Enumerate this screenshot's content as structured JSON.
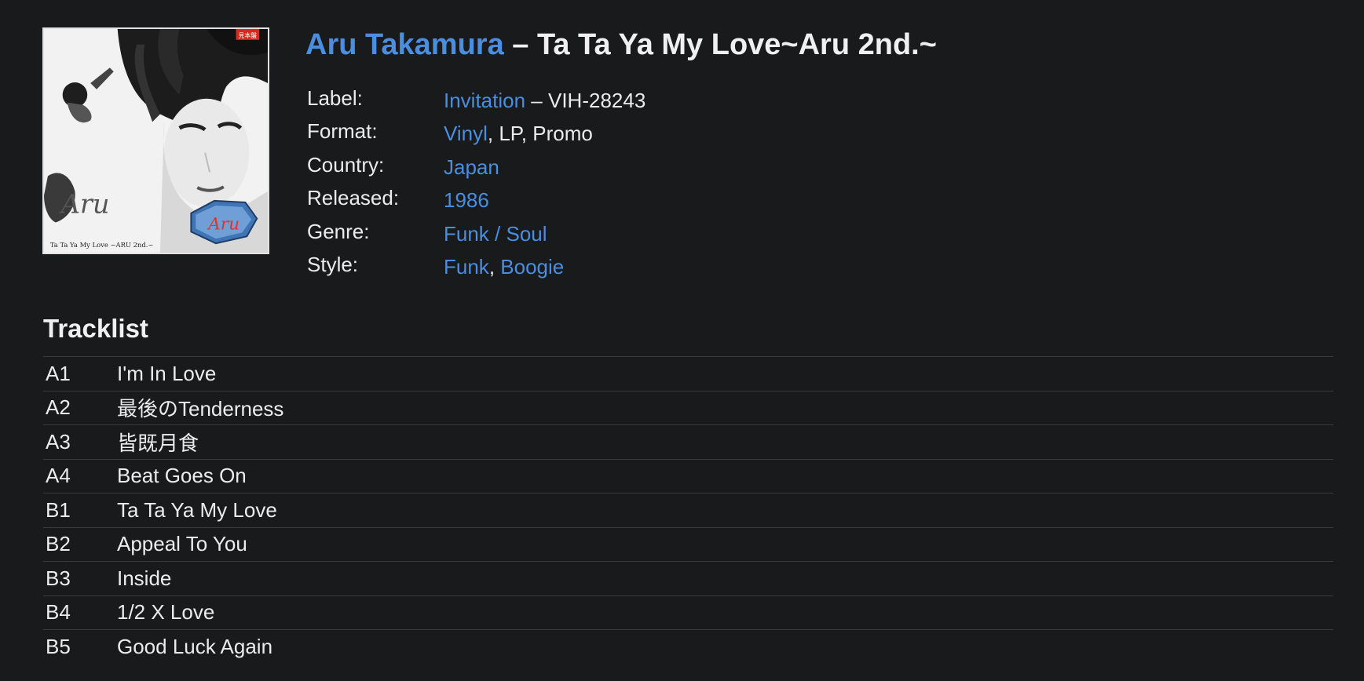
{
  "release": {
    "artist": "Aru Takamura",
    "separator": " – ",
    "title": "Ta Ta Ya My Love~Aru 2nd.~",
    "cover_alt": "Album cover art"
  },
  "info": {
    "label_key": "Label:",
    "label_link": "Invitation",
    "label_catno": " – VIH-28243",
    "format_key": "Format:",
    "format_link": "Vinyl",
    "format_rest": ", LP, Promo",
    "country_key": "Country:",
    "country_link": "Japan",
    "released_key": "Released:",
    "released_link": "1986",
    "genre_key": "Genre:",
    "genre_link": "Funk / Soul",
    "style_key": "Style:",
    "style_link_1": "Funk",
    "style_sep": ", ",
    "style_link_2": "Boogie"
  },
  "tracklist": {
    "heading": "Tracklist",
    "tracks": [
      {
        "position": "A1",
        "title": "I'm In Love"
      },
      {
        "position": "A2",
        "title": "最後のTenderness"
      },
      {
        "position": "A3",
        "title": "皆既月食"
      },
      {
        "position": "A4",
        "title": "Beat Goes On"
      },
      {
        "position": "B1",
        "title": "Ta Ta Ya My Love"
      },
      {
        "position": "B2",
        "title": "Appeal To You"
      },
      {
        "position": "B3",
        "title": "Inside"
      },
      {
        "position": "B4",
        "title": "1/2 X Love"
      },
      {
        "position": "B5",
        "title": "Good Luck Again"
      }
    ]
  },
  "cover_art": {
    "sticker_text": "見本盤",
    "cover_caption": "Ta Ta Ya My Love ~ARU 2nd.~",
    "script_logo": "Aru",
    "badge_logo": "Aru"
  },
  "colors": {
    "background": "#191a1c",
    "link": "#4a8ee0",
    "text": "#ececec",
    "divider": "#3a3b3e"
  }
}
